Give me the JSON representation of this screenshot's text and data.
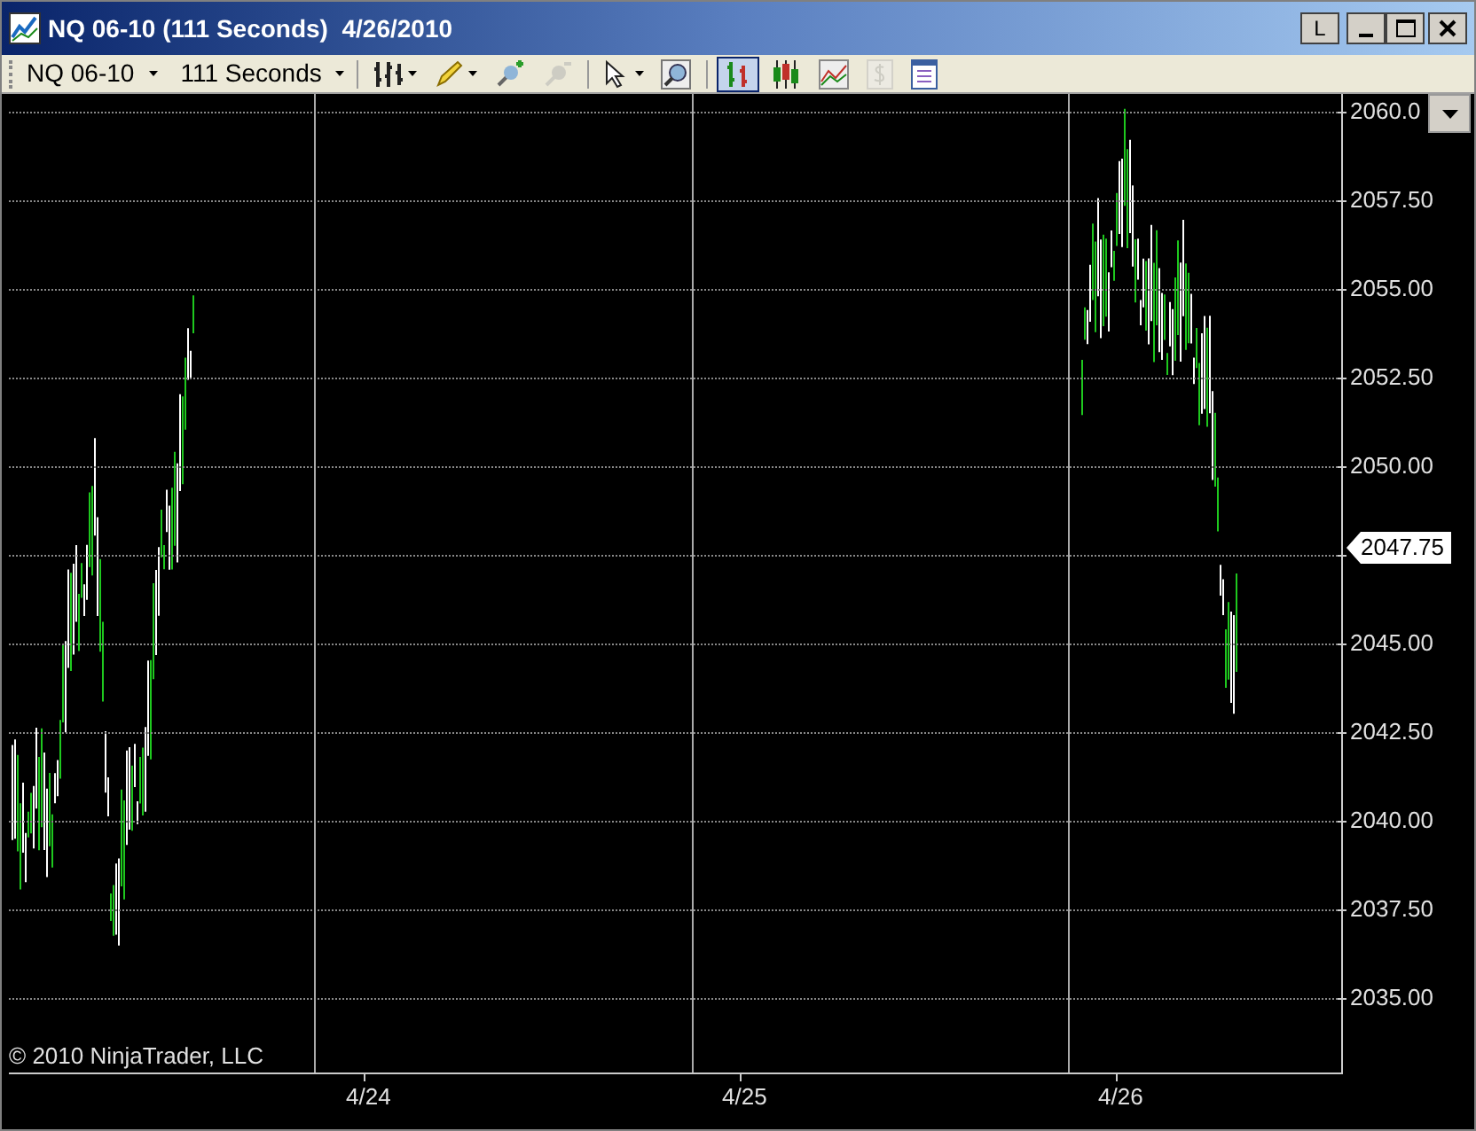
{
  "window": {
    "title": "NQ 06-10 (111 Seconds)  4/26/2010",
    "buttons": [
      {
        "kind": "letter",
        "label": "L"
      },
      {
        "kind": "minimize"
      },
      {
        "kind": "maximize"
      },
      {
        "kind": "close"
      }
    ]
  },
  "toolbar": {
    "instrument": "NQ 06-10",
    "interval": "111 Seconds",
    "tools": [
      {
        "kind": "bars",
        "disabled": false,
        "selected": false,
        "menu": true
      },
      {
        "kind": "pencil",
        "disabled": false,
        "selected": false,
        "menu": true
      },
      {
        "kind": "zoomin",
        "disabled": false,
        "selected": false,
        "menu": false
      },
      {
        "kind": "zoomout",
        "disabled": true,
        "selected": false,
        "menu": false
      },
      {
        "kind": "pointer",
        "disabled": false,
        "selected": false,
        "menu": true
      },
      {
        "kind": "magnifier",
        "disabled": false,
        "selected": false,
        "menu": false
      },
      {
        "kind": "ohlc",
        "disabled": false,
        "selected": true,
        "menu": false
      },
      {
        "kind": "candles",
        "disabled": false,
        "selected": false,
        "menu": false
      },
      {
        "kind": "linechart",
        "disabled": false,
        "selected": false,
        "menu": false
      },
      {
        "kind": "dollar",
        "disabled": true,
        "selected": false,
        "menu": false
      },
      {
        "kind": "panel",
        "disabled": false,
        "selected": false,
        "menu": false
      }
    ]
  },
  "chart": {
    "price_labels": [
      "2060.0",
      "2057.50",
      "2055.00",
      "2052.50",
      "2050.00",
      "2045.00",
      "2042.50",
      "2040.00",
      "2037.50",
      "2035.00"
    ],
    "date_labels": [
      "4/24",
      "4/25",
      "4/26"
    ],
    "last_price": "2047.75",
    "copyright": "© 2010 NinjaTrader, LLC"
  }
}
